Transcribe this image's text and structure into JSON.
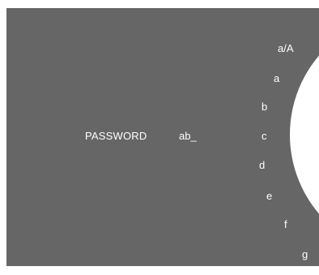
{
  "password": {
    "label": "PASSWORD",
    "value": "ab_"
  },
  "char_wheel": {
    "case_toggle": "a/A",
    "chars": [
      "a",
      "b",
      "c",
      "d",
      "e",
      "f",
      "g"
    ]
  },
  "colors": {
    "panel_bg": "#666666",
    "text": "#ffffff",
    "wheel": "#ffffff"
  }
}
